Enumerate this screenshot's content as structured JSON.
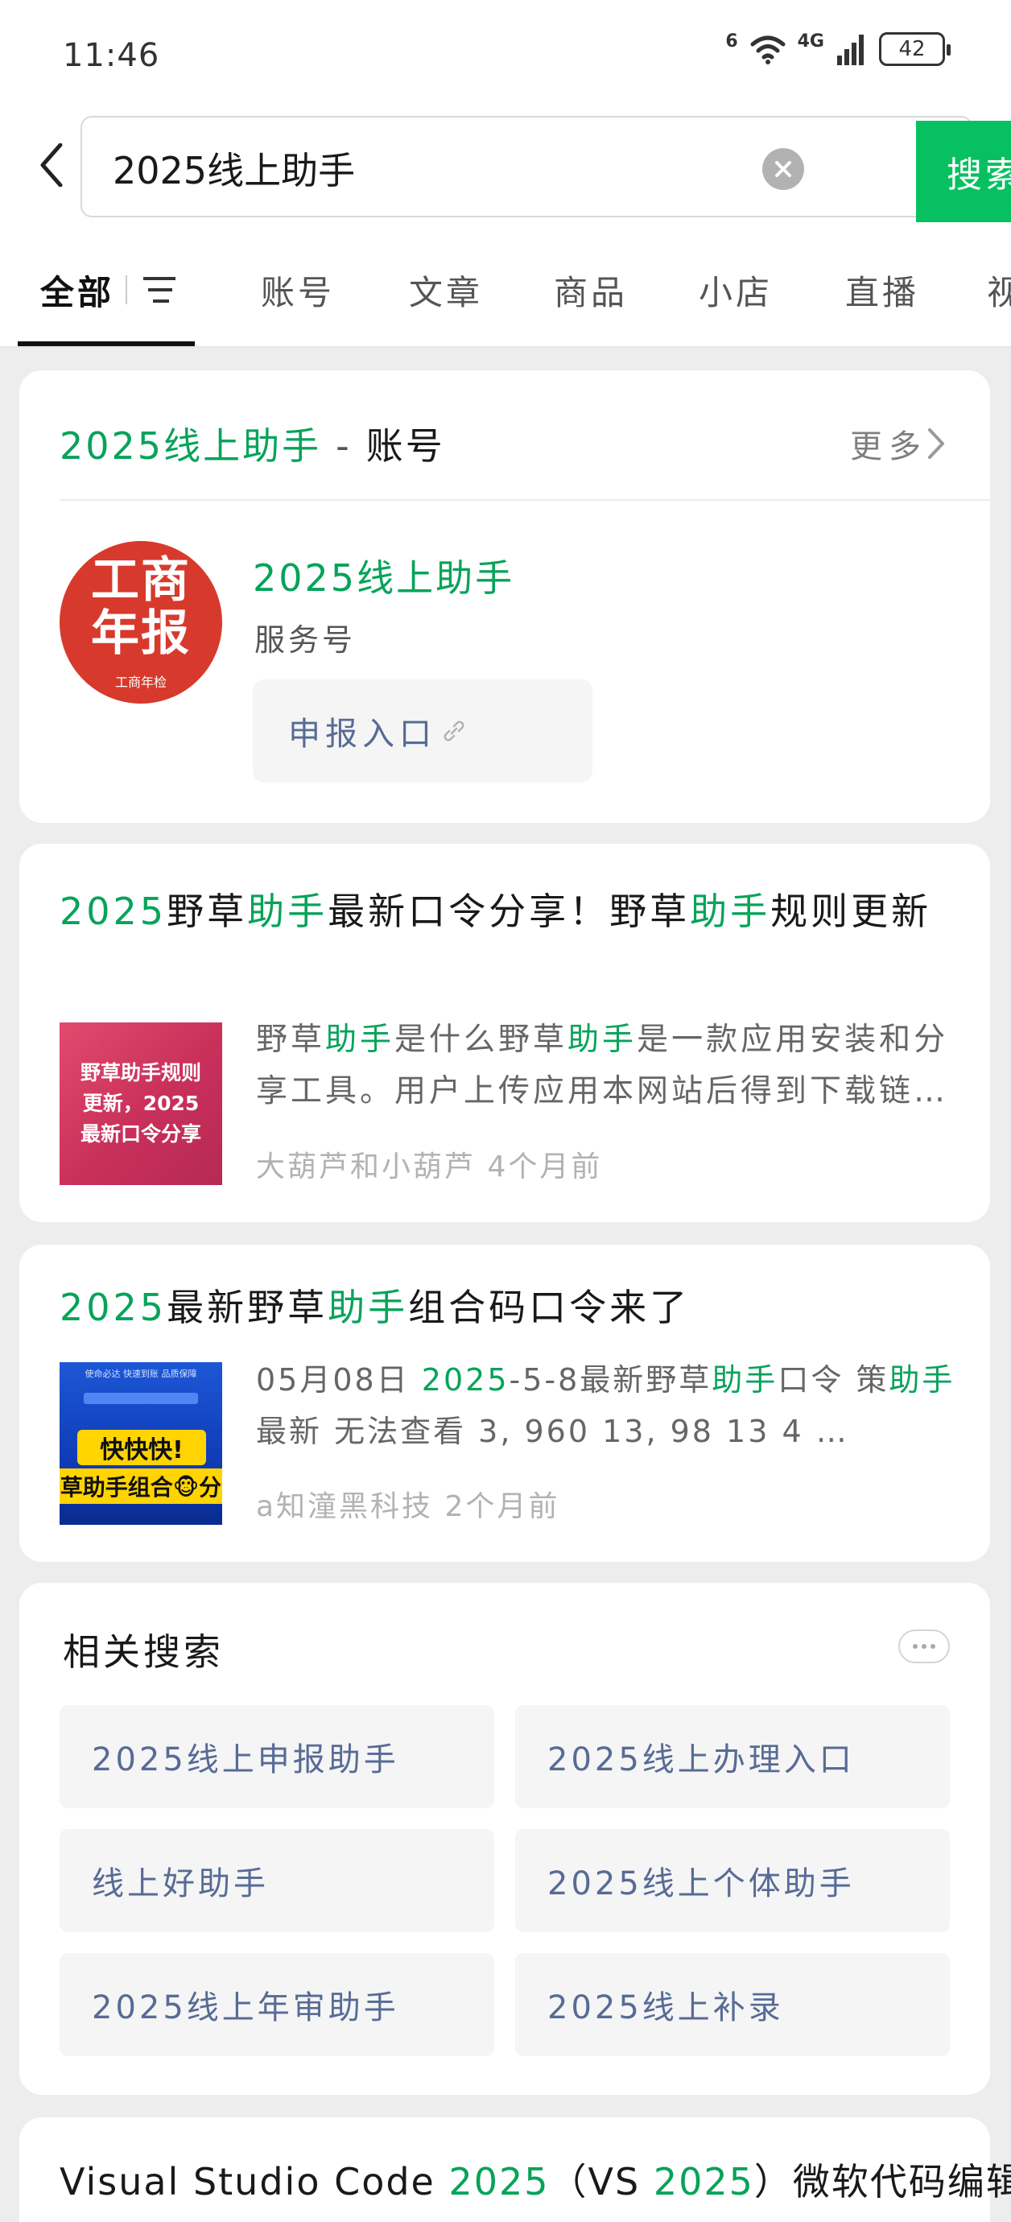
{
  "status_bar": {
    "time": "11:46",
    "wifi_label": "6",
    "network_label": "4G",
    "battery": "42"
  },
  "search": {
    "query": "2025线上助手",
    "button_label": "搜索"
  },
  "tabs": [
    "全部",
    "账号",
    "文章",
    "商品",
    "小店",
    "直播",
    "视"
  ],
  "account_card": {
    "header_name": "2025线上助手",
    "header_dash": "-",
    "header_type": "账号",
    "more_label": "更多",
    "avatar_line1": "工商",
    "avatar_line2": "年报",
    "avatar_caption": "工商年检",
    "account_name": "2025线上助手",
    "account_type": "服务号",
    "menu_label": "申报入口"
  },
  "articles": [
    {
      "title_parts": [
        "2025",
        "野草",
        "助手",
        "最新口令分享！野草",
        "助手",
        "规则更新"
      ],
      "thumb_text": "野草助手规则更新，2025最新口令分享",
      "desc_parts": [
        "野草",
        "助手",
        "是什么野草",
        "助手",
        "是一款应用安装和分享工具。用户上传应用本网站后得到下载链接与二维码"
      ],
      "meta": "大葫芦和小葫芦  4个月前"
    },
    {
      "title_parts": [
        "2025",
        "最新野草",
        "助手",
        "组合码口令来了"
      ],
      "thumb_top": "使命必达  快速到账  品质保障",
      "thumb_y1": "快快快!",
      "thumb_y2": "草助手组合🐵分",
      "desc_parts": [
        "05月08日  ",
        "2025",
        "-5-8最新野草",
        "助手",
        "口令  策",
        "助手",
        "最新  无法查看  3, 960  13,   98  13  4  …"
      ],
      "meta": "a知潼黑科技  2个月前"
    }
  ],
  "related": {
    "title": "相关搜索",
    "items": [
      "2025线上申报助手",
      "2025线上办理入口",
      "线上好助手",
      "2025线上个体助手",
      "2025线上年审助手",
      "2025线上补录"
    ]
  },
  "bottom_article": {
    "title_parts": [
      "Visual Studio Code ",
      "2025",
      "（VS ",
      "2025",
      "）微软代码编辑"
    ]
  },
  "colors": {
    "accent_green": "#07c160",
    "highlight_green": "#07a35a",
    "link_blue": "#576b95",
    "avatar_red": "#d73a2c"
  }
}
